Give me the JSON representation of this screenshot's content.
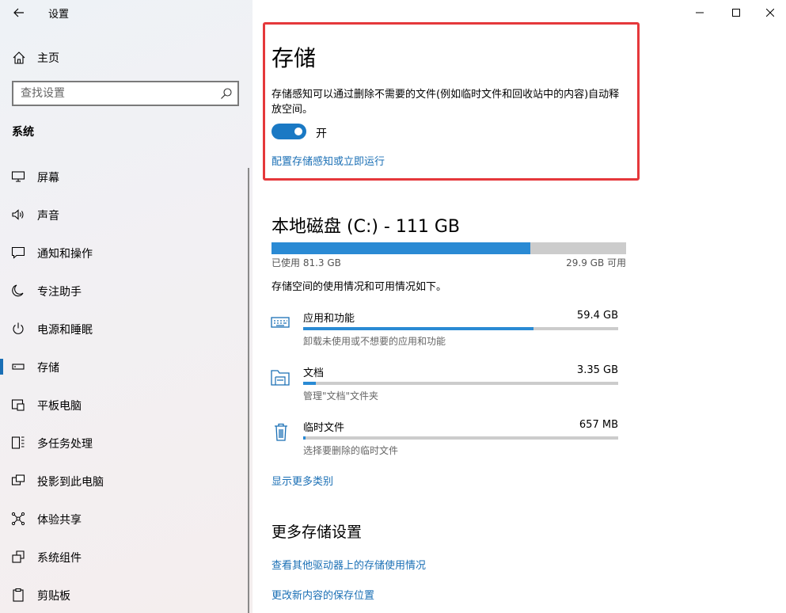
{
  "window": {
    "title": "设置"
  },
  "sidebar": {
    "home_label": "主页",
    "search_placeholder": "查找设置",
    "section_label": "系统",
    "items": [
      {
        "label": "屏幕",
        "icon": "display-icon"
      },
      {
        "label": "声音",
        "icon": "speaker-icon"
      },
      {
        "label": "通知和操作",
        "icon": "message-icon"
      },
      {
        "label": "专注助手",
        "icon": "moon-icon"
      },
      {
        "label": "电源和睡眠",
        "icon": "power-icon"
      },
      {
        "label": "存储",
        "icon": "storage-icon",
        "active": true
      },
      {
        "label": "平板电脑",
        "icon": "tablet-icon"
      },
      {
        "label": "多任务处理",
        "icon": "multitask-icon"
      },
      {
        "label": "投影到此电脑",
        "icon": "project-icon"
      },
      {
        "label": "体验共享",
        "icon": "share-icon"
      },
      {
        "label": "系统组件",
        "icon": "components-icon"
      },
      {
        "label": "剪贴板",
        "icon": "clipboard-icon"
      }
    ]
  },
  "storage_sense": {
    "title": "存储",
    "description": "存储感知可以通过删除不需要的文件(例如临时文件和回收站中的内容)自动释放空间。",
    "toggle_state": "开",
    "toggle_on": true,
    "configure_link": "配置存储感知或立即运行"
  },
  "local_disk": {
    "title": "本地磁盘 (C:) - 111 GB",
    "used_label": "已使用 81.3 GB",
    "free_label": "29.9 GB 可用",
    "used_fraction": 0.731,
    "usage_description": "存储空间的使用情况和可用情况如下。",
    "categories": [
      {
        "name": "应用和功能",
        "size": "59.4 GB",
        "description": "卸载未使用或不想要的应用和功能",
        "fraction": 0.73,
        "icon": "keyboard-icon"
      },
      {
        "name": "文档",
        "size": "3.35 GB",
        "description": "管理\"文档\"文件夹",
        "fraction": 0.04,
        "icon": "folder-icon"
      },
      {
        "name": "临时文件",
        "size": "657 MB",
        "description": "选择要删除的临时文件",
        "fraction": 0.008,
        "icon": "trash-icon"
      }
    ],
    "show_more_link": "显示更多类别"
  },
  "more_settings": {
    "title": "更多存储设置",
    "links": [
      "查看其他驱动器上的存储使用情况",
      "更改新内容的保存位置"
    ]
  },
  "colors": {
    "accent": "#2a8ad4",
    "link": "#1a6fb5",
    "highlight_border": "#e5383b"
  }
}
